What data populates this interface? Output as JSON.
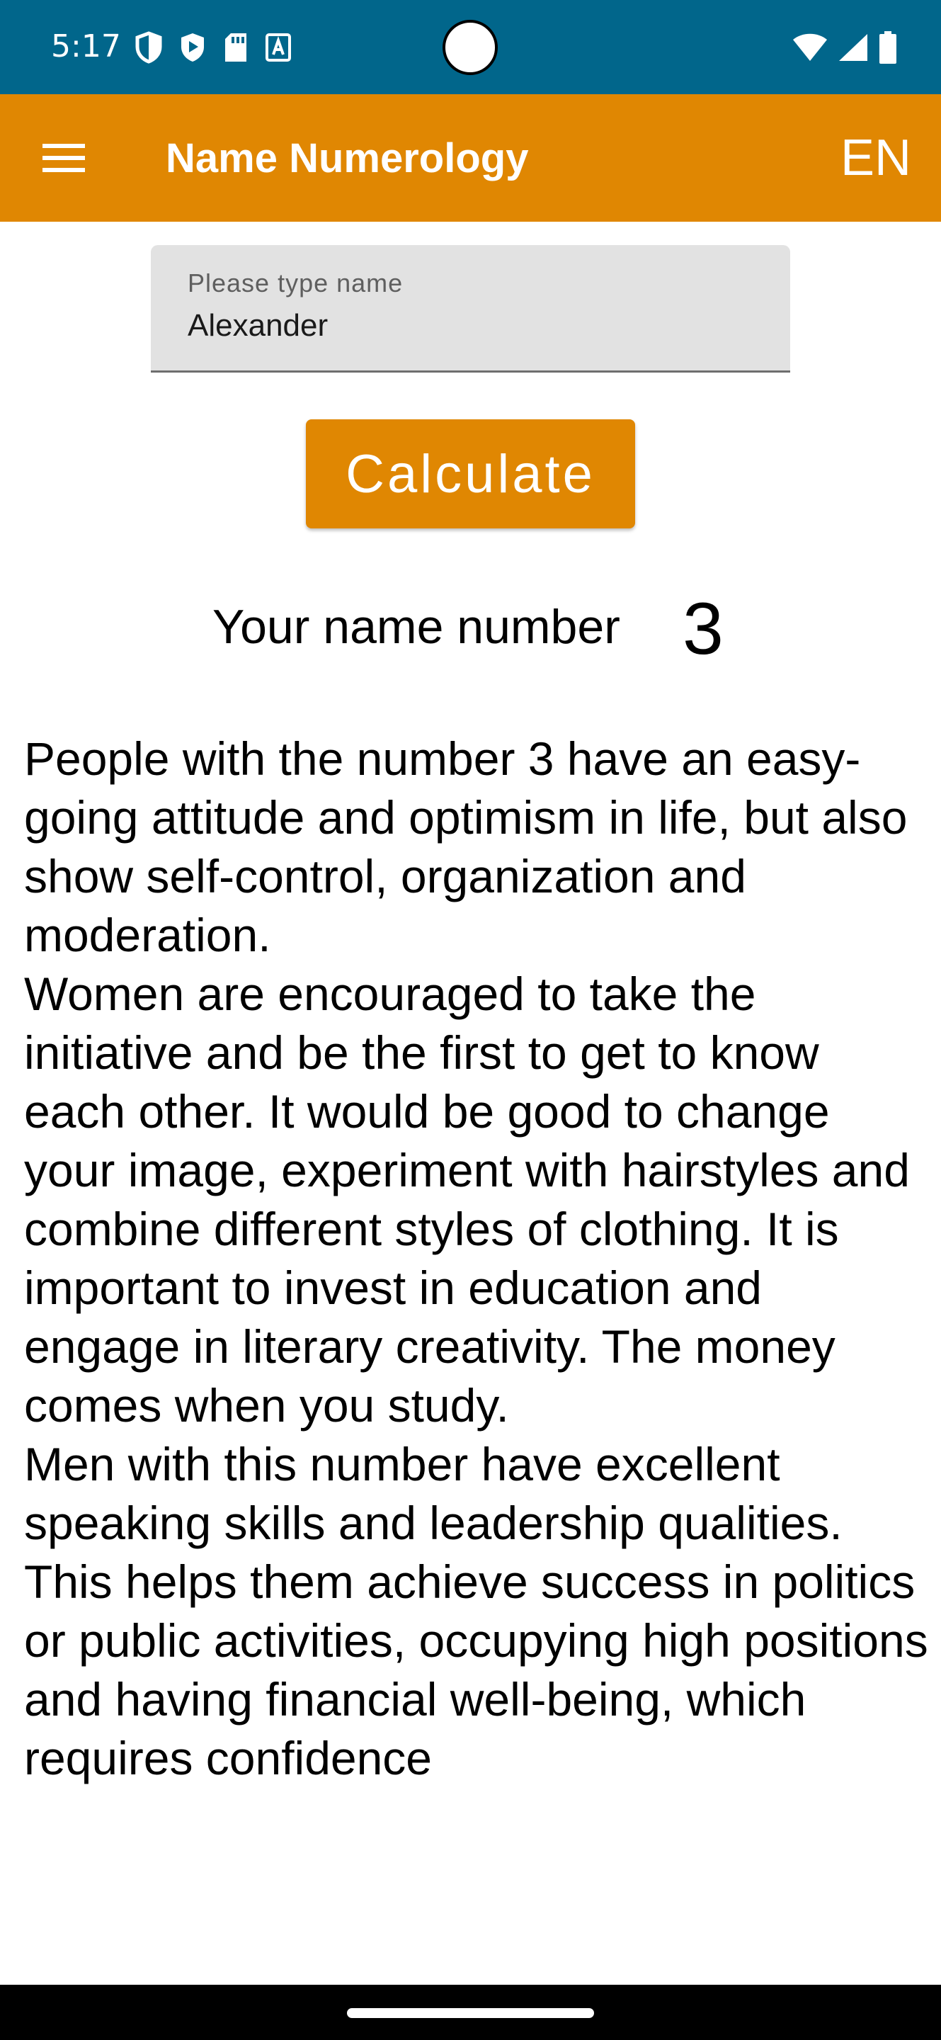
{
  "status_bar": {
    "time": "5:17",
    "background_color": "#01668b",
    "left_icons": [
      "shield-icon",
      "play-protect-icon",
      "sd-card-icon",
      "a-letter-icon"
    ],
    "right_icons": [
      "wifi-icon",
      "signal-icon",
      "battery-icon"
    ]
  },
  "app_bar": {
    "title": "Name Numerology",
    "language": "EN",
    "menu_icon": "menu-icon",
    "background_color": "#e08702"
  },
  "name_field": {
    "label": "Please type name",
    "value": "Alexander"
  },
  "calculate_button": {
    "label": "Calculate",
    "color": "#e08702"
  },
  "result": {
    "label": "Your name number",
    "number": "3"
  },
  "description": "People with the number 3 have an easy-going attitude and optimism in life, but also show self-control, organization and moderation.\nWomen are encouraged to take the initiative and be the first to get to know each other. It would be good to change your image, experiment with hairstyles and combine different styles of clothing. It is important to invest in education and engage in literary creativity. The money comes when you study.\nMen with this number have excellent speaking skills and leadership qualities. This helps them achieve success in politics or public activities, occupying high positions and having financial well-being, which requires confidence"
}
